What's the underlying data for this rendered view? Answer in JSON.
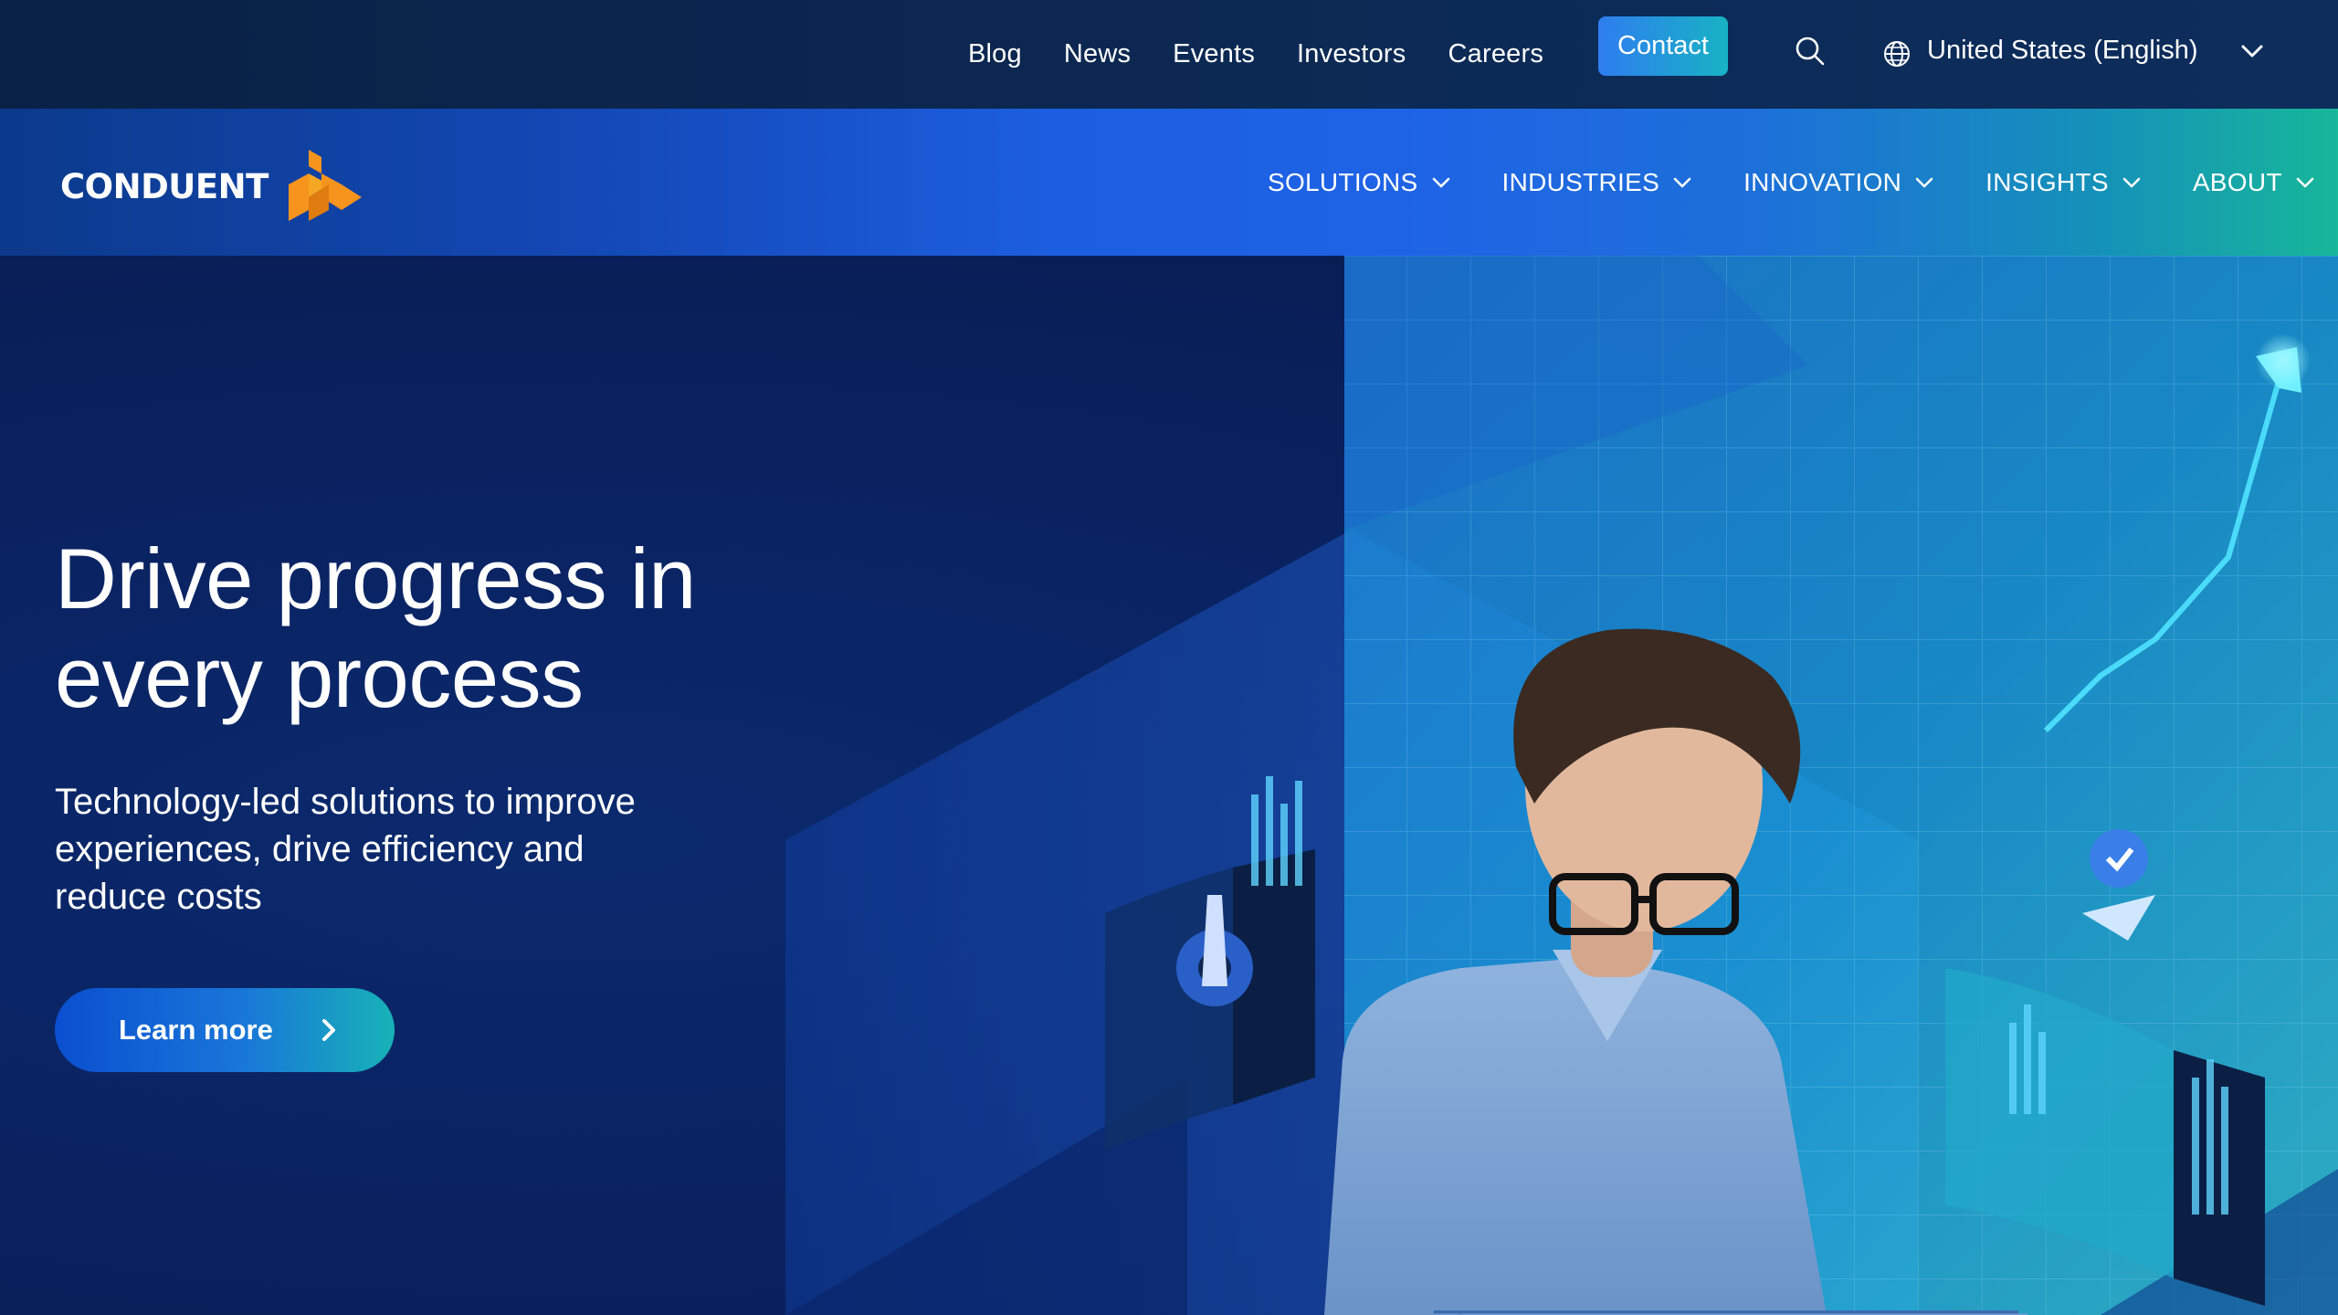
{
  "utility": {
    "links": [
      "Blog",
      "News",
      "Events",
      "Investors",
      "Careers"
    ],
    "contact_label": "Contact",
    "locale_label": "United States (English)"
  },
  "nav": {
    "logo_text": "CONDUENT",
    "items": [
      "SOLUTIONS",
      "INDUSTRIES",
      "INNOVATION",
      "INSIGHTS",
      "ABOUT"
    ]
  },
  "hero": {
    "title": "Drive progress in every process",
    "subtitle": "Technology-led solutions to improve experiences, drive efficiency and reduce costs",
    "cta_label": "Learn more"
  },
  "icons": {
    "search": "search-icon",
    "globe": "globe-icon",
    "chevron": "chevron-down-icon",
    "cta_arrow": "chevron-right-icon"
  },
  "colors": {
    "utility_bg": "#0a2146",
    "contact_start": "#2f7df0",
    "contact_end": "#17b3c4",
    "brand_orange": "#f7941d",
    "hero_bg": "#081a4d"
  }
}
